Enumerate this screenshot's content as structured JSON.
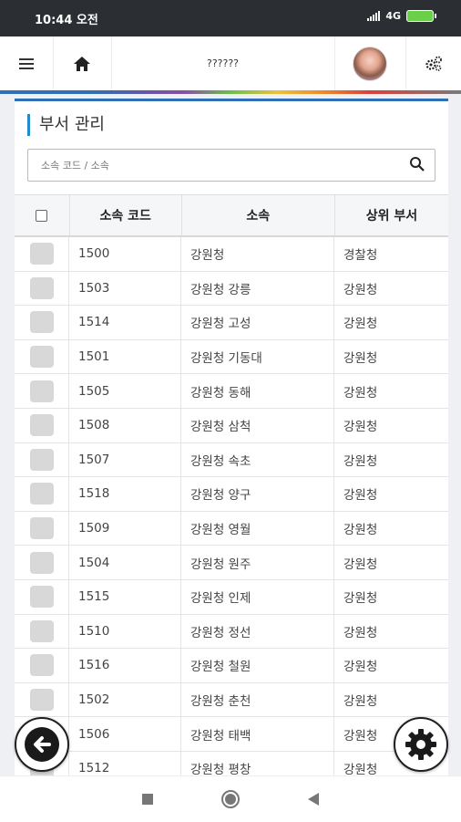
{
  "status_bar": {
    "time": "10:44 오전",
    "network": "4G",
    "icons": [
      "signal-icon",
      "battery-icon"
    ]
  },
  "app_bar": {
    "title": "??????",
    "icons": [
      "menu-icon",
      "home-icon",
      "avatar",
      "settings-cogs-icon"
    ]
  },
  "panel": {
    "title": "부서 관리",
    "search": {
      "placeholder": "소속 코드 / 소속",
      "value": ""
    }
  },
  "table": {
    "headers": [
      "",
      "소속 코드",
      "소속",
      "상위 부서"
    ],
    "rows": [
      {
        "code": "1500",
        "name": "강원청",
        "parent": "경찰청"
      },
      {
        "code": "1503",
        "name": "강원청 강릉",
        "parent": "강원청"
      },
      {
        "code": "1514",
        "name": "강원청 고성",
        "parent": "강원청"
      },
      {
        "code": "1501",
        "name": "강원청 기동대",
        "parent": "강원청"
      },
      {
        "code": "1505",
        "name": "강원청 동해",
        "parent": "강원청"
      },
      {
        "code": "1508",
        "name": "강원청 삼척",
        "parent": "강원청"
      },
      {
        "code": "1507",
        "name": "강원청 속초",
        "parent": "강원청"
      },
      {
        "code": "1518",
        "name": "강원청 양구",
        "parent": "강원청"
      },
      {
        "code": "1509",
        "name": "강원청 영월",
        "parent": "강원청"
      },
      {
        "code": "1504",
        "name": "강원청 원주",
        "parent": "강원청"
      },
      {
        "code": "1515",
        "name": "강원청 인제",
        "parent": "강원청"
      },
      {
        "code": "1510",
        "name": "강원청 정선",
        "parent": "강원청"
      },
      {
        "code": "1516",
        "name": "강원청 철원",
        "parent": "강원청"
      },
      {
        "code": "1502",
        "name": "강원청 춘천",
        "parent": "강원청"
      },
      {
        "code": "1506",
        "name": "강원청 태백",
        "parent": "강원청"
      },
      {
        "code": "1512",
        "name": "강원청 평창",
        "parent": "강원청"
      }
    ]
  },
  "fabs": {
    "left": "back-arrow-icon",
    "right": "settings-gear-icon"
  },
  "nav_bar": {
    "icons": [
      "recent-apps-icon",
      "home-circle-icon",
      "back-triangle-icon"
    ]
  },
  "colors": {
    "status_bar": "#2b2f33",
    "accent": "#2f6fb5",
    "title_bar_marker": "#1f8ad0"
  }
}
